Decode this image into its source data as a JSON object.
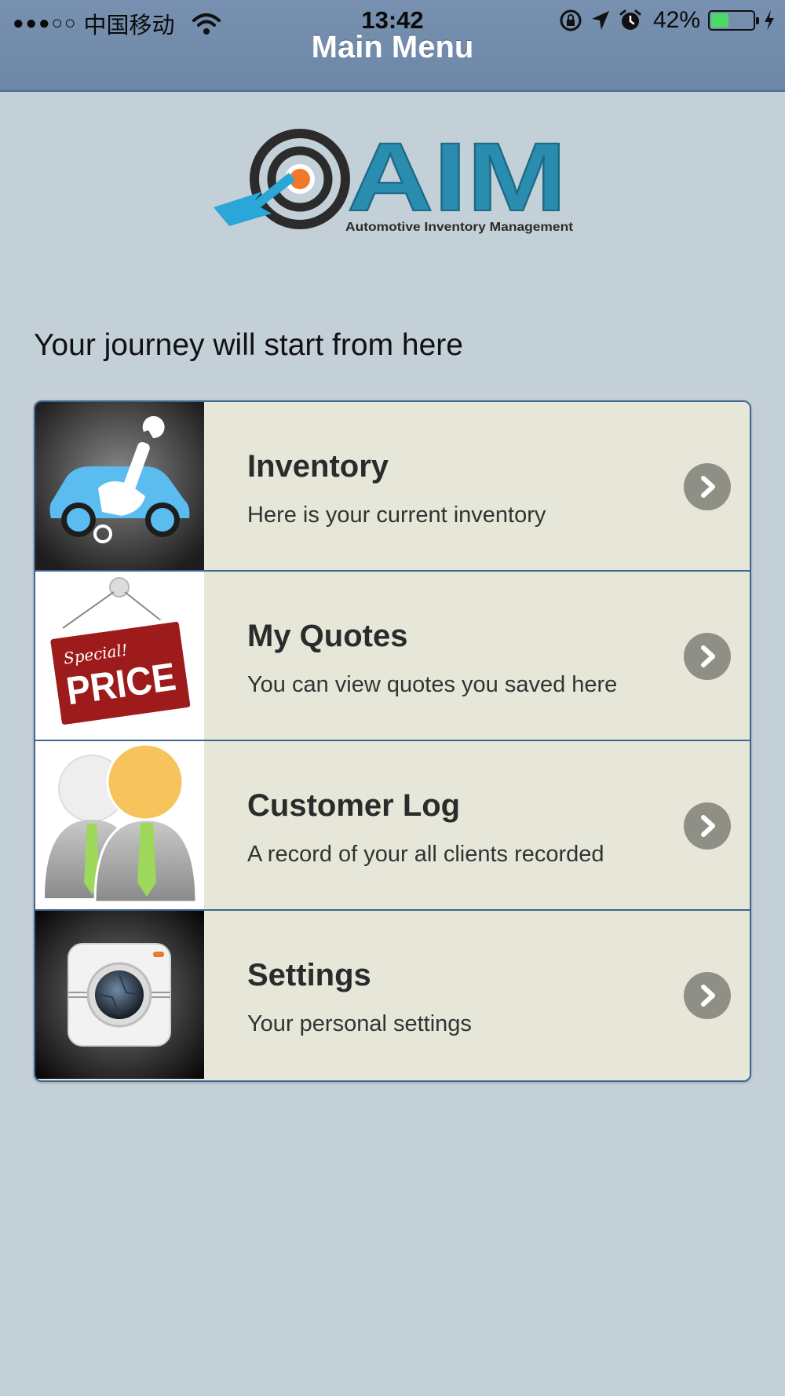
{
  "status_bar": {
    "signal_dots": "●●●○○",
    "carrier": "中国移动",
    "time": "13:42",
    "battery_percent": "42%",
    "battery_level": 0.42,
    "icons": [
      "wifi-icon",
      "orientation-lock-icon",
      "location-arrow-icon",
      "alarm-icon",
      "charging-bolt-icon"
    ]
  },
  "nav": {
    "title": "Main Menu"
  },
  "logo": {
    "brand": "AIM",
    "tagline": "Automotive Inventory Management",
    "colors": {
      "brand_blue": "#2a8db0",
      "target_dark": "#2b2b2b",
      "bullseye_orange": "#f0782a",
      "arrow_blue": "#2aa6d8"
    }
  },
  "intro": {
    "text": "Your journey will start from here"
  },
  "menu": {
    "items": [
      {
        "title": "Inventory",
        "description": "Here is your current inventory",
        "thumb_icon": "car-wrench-icon"
      },
      {
        "title": "My Quotes",
        "description": "You can view quotes you saved here",
        "thumb_icon": "special-price-sign-icon",
        "sign_line1": "Special!",
        "sign_line2": "PRICE"
      },
      {
        "title": "Customer Log",
        "description": "A record of your all clients recorded",
        "thumb_icon": "customers-icon"
      },
      {
        "title": "Settings",
        "description": "Your personal settings",
        "thumb_icon": "camera-icon"
      }
    ]
  },
  "colors": {
    "nav_bar": "#7891b0",
    "page_background": "#c4d0d7",
    "list_background": "#e6e6d9",
    "list_border": "#3f6690",
    "chevron": "#8f8f85"
  }
}
